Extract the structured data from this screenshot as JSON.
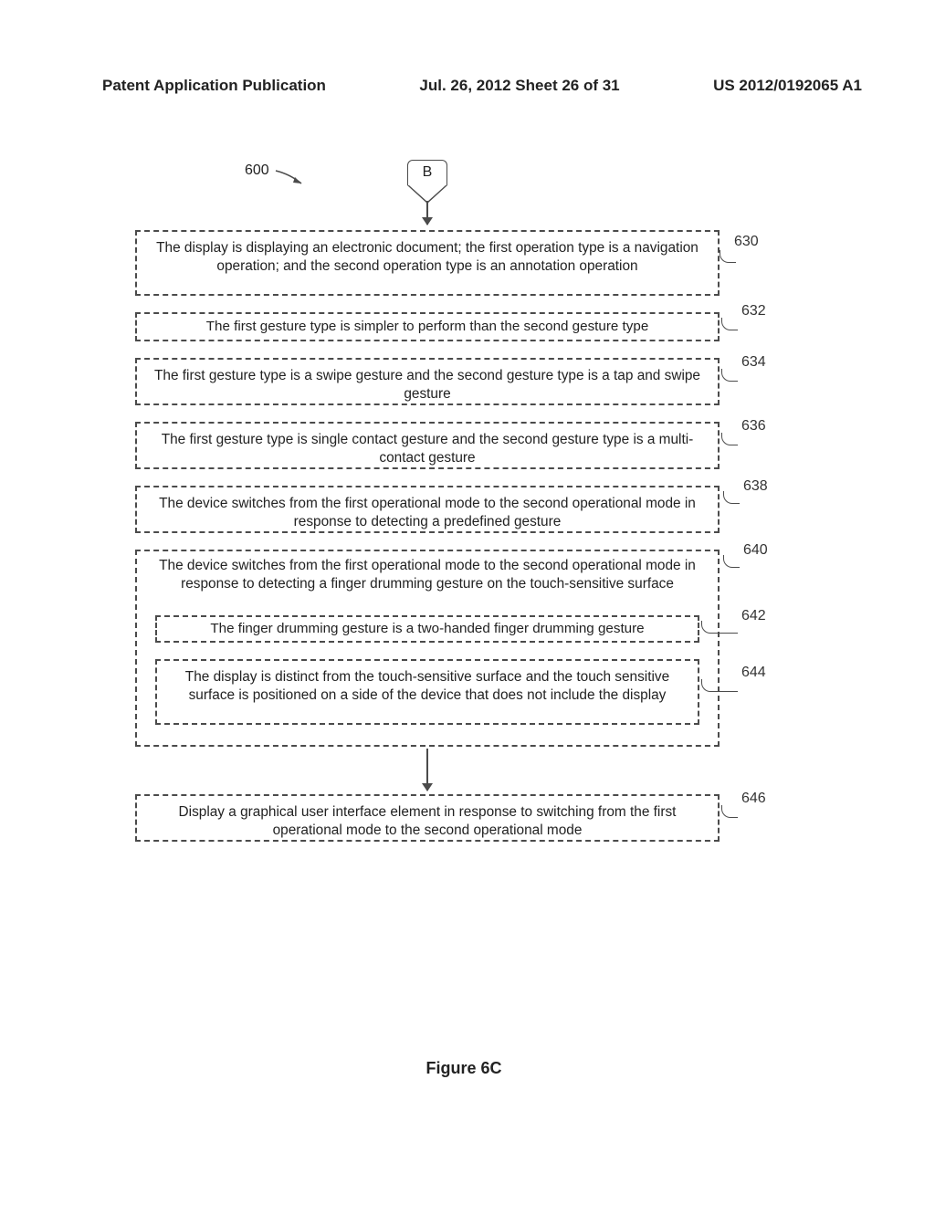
{
  "header": {
    "left": "Patent Application Publication",
    "center": "Jul. 26, 2012  Sheet 26 of 31",
    "right": "US 2012/0192065 A1"
  },
  "diagram": {
    "flow_label": "600",
    "connector_label": "B",
    "boxes": {
      "b630": {
        "ref": "630",
        "text": "The display is displaying an electronic document; the first operation type is a navigation operation; and the second operation type is an annotation operation"
      },
      "b632": {
        "ref": "632",
        "text": "The first gesture type is simpler to perform than the second gesture type"
      },
      "b634": {
        "ref": "634",
        "text": "The first gesture type is a swipe gesture and the second gesture type is a tap and swipe gesture"
      },
      "b636": {
        "ref": "636",
        "text": "The first gesture type is single contact gesture and the second gesture type is a multi-contact gesture"
      },
      "b638": {
        "ref": "638",
        "text": "The device switches from the first operational mode to the second operational mode in response to detecting a predefined gesture"
      },
      "b640": {
        "ref": "640",
        "text": "The device switches from the first operational mode to the second operational mode in response to detecting a finger drumming gesture on the touch-sensitive surface"
      },
      "b642": {
        "ref": "642",
        "text": "The finger drumming gesture is a two-handed finger drumming gesture"
      },
      "b644": {
        "ref": "644",
        "text": "The display is distinct from the touch-sensitive surface and the touch sensitive surface is positioned on a side of the device that does not include the display"
      },
      "b646": {
        "ref": "646",
        "text": "Display a graphical user interface element in response to switching from the first operational mode to the second operational mode"
      }
    },
    "figure_caption": "Figure 6C"
  }
}
